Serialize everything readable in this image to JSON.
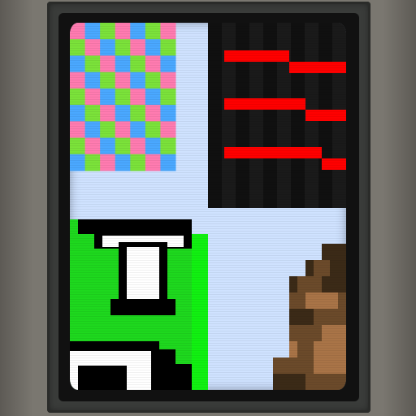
{
  "colors": {
    "case": "#6f6c66",
    "bezel": "#3a3c3a",
    "background": "#cfe2ff",
    "checker": [
      "#ff7bb0",
      "#7be23a",
      "#4aa8ff"
    ],
    "bars_bg": "#141414",
    "bars": "#ff0000",
    "face_green": "#1ed81e",
    "face_bright": "#11f111",
    "outline": "#000000",
    "white": "#ffffff",
    "skin_dark": "#3b2a17",
    "skin_mid": "#6b4a2a",
    "skin_light": "#a97447"
  },
  "panels": [
    {
      "id": "checker",
      "type": "checker",
      "cols": 7,
      "rows": 9
    },
    {
      "id": "red-bars",
      "type": "staircase-bars",
      "count": 3
    },
    {
      "id": "green-creature",
      "type": "pixel-sprite"
    },
    {
      "id": "brown-figure",
      "type": "pixel-sprite"
    }
  ]
}
